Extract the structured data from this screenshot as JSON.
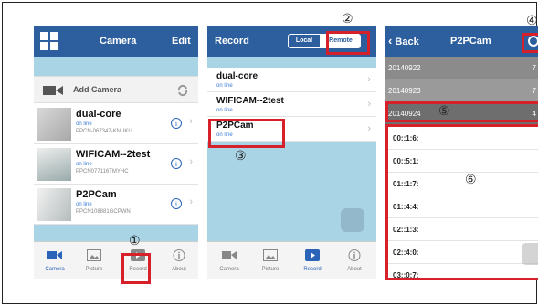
{
  "markers": [
    "①",
    "②",
    "③",
    "④",
    "⑤",
    "⑥"
  ],
  "colors": {
    "nav_bar": "#2d5f9e",
    "accent": "#2a63b8",
    "highlight_box": "#d6202a",
    "light_blue": "#a9d4e6"
  },
  "tabs": [
    {
      "label": "Camera",
      "icon": "camera-icon"
    },
    {
      "label": "Picture",
      "icon": "picture-icon"
    },
    {
      "label": "Record",
      "icon": "record-play-icon"
    },
    {
      "label": "About",
      "icon": "info-icon"
    }
  ],
  "camera_screen": {
    "title": "Camera",
    "edit_label": "Edit",
    "add_camera_label": "Add Camera",
    "cameras": [
      {
        "name": "dual-core",
        "status": "on line",
        "uid": "PPCN-067347-KNUKU"
      },
      {
        "name": "WIFICAM--2test",
        "status": "on line",
        "uid": "PPCN077116TMYHC"
      },
      {
        "name": "P2PCam",
        "status": "on line",
        "uid": "PPCN108881GCPWN"
      }
    ],
    "active_tab": "Camera"
  },
  "record_screen": {
    "title": "Record",
    "segments": [
      "Local",
      "Remote"
    ],
    "selected_segment": "Remote",
    "devices": [
      {
        "name": "dual-core",
        "status": "on line"
      },
      {
        "name": "WIFICAM--2test",
        "status": "on line"
      },
      {
        "name": "P2PCam",
        "status": "on line"
      }
    ],
    "active_tab": "Record"
  },
  "p2pcam_screen": {
    "back_label": "Back",
    "title": "P2PCam",
    "dates": [
      {
        "date": "20140922",
        "count": "7"
      },
      {
        "date": "20140923",
        "count": "7"
      },
      {
        "date": "20140924",
        "count": "4"
      }
    ],
    "times": [
      "00::1:6:",
      "00::5:1:",
      "01::1:7:",
      "01::4:4:",
      "02::1:3:",
      "02::4:0:",
      "03::0:7:"
    ]
  }
}
